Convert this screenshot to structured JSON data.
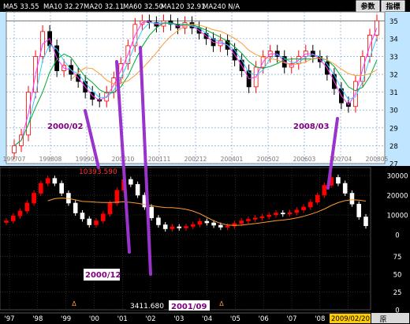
{
  "toolbar": {
    "ma_readouts": [
      {
        "label": "MA5 33.55",
        "color": "#ffffff"
      },
      {
        "label": "MA10 32.27",
        "color": "#ffffff"
      },
      {
        "label": "MA20 32.11",
        "color": "#ffffff"
      },
      {
        "label": "MA60 32.50",
        "color": "#ffffff"
      },
      {
        "label": "MA120 32.91",
        "color": "#ffffff"
      },
      {
        "label": "MA240 N/A",
        "color": "#ffffff"
      }
    ],
    "buttons": [
      "参数",
      "指標"
    ]
  },
  "chart_data": [
    {
      "type": "line",
      "panel": "top",
      "x_ticks": [
        "199707",
        "199808",
        "199909",
        "200010",
        "200111",
        "200212",
        "200401",
        "200502",
        "200603",
        "200704",
        "200805"
      ],
      "y_ticks": [
        27,
        28,
        29,
        30,
        31,
        32,
        33,
        34,
        35
      ],
      "ylim": [
        27,
        35.5
      ],
      "series": [
        {
          "kind": "candlestick-close",
          "values": [
            28.0,
            28.6,
            31.0,
            33.0,
            34.4,
            33.6,
            32.2,
            32.5,
            32.0,
            31.6,
            31.0,
            30.6,
            30.5,
            31.0,
            31.8,
            32.6,
            33.6,
            34.8,
            35.0,
            34.9,
            34.7,
            35.0,
            34.8,
            34.6,
            34.9,
            34.6,
            34.3,
            34.0,
            33.6,
            33.9,
            33.4,
            32.8,
            32.2,
            31.3,
            32.4,
            33.0,
            33.3,
            33.0,
            32.4,
            32.6,
            33.0,
            33.3,
            33.0,
            32.7,
            32.0,
            31.2,
            30.4,
            30.2,
            31.6,
            33.0,
            34.2,
            35.0
          ]
        },
        {
          "name": "MA5",
          "color": "#ff33ff"
        },
        {
          "name": "MA10",
          "color": "#33ccff"
        },
        {
          "name": "MA20",
          "color": "#00aa33"
        },
        {
          "name": "MA60",
          "color": "#ff9933"
        }
      ],
      "annotations": [
        {
          "text": "2000/02",
          "color": "#800080"
        },
        {
          "text": "2008/03",
          "color": "#800080"
        }
      ]
    },
    {
      "type": "line",
      "panel": "bottom",
      "x_ticks": [
        "'97",
        "'98",
        "'99",
        "'00",
        "'01",
        "'02",
        "'03",
        "'04",
        "'05",
        "'06",
        "'07",
        "'08",
        "'09"
      ],
      "y_ticks_upper": [
        0,
        10000,
        20000,
        30000
      ],
      "y_ticks_lower": [
        0,
        25,
        50,
        75
      ],
      "upper_ylim": [
        -4000,
        34000
      ],
      "lower_ylim": [
        0,
        100
      ],
      "series": [
        {
          "kind": "candlestick-close",
          "values": [
            7000,
            9500,
            12000,
            16000,
            21000,
            26000,
            28500,
            26000,
            21000,
            16000,
            11000,
            8000,
            5000,
            7000,
            10500,
            16000,
            22500,
            28000,
            25500,
            20000,
            14000,
            8500,
            5000,
            3000,
            4000,
            3411.68,
            4200,
            5200,
            6800,
            6000,
            4800,
            3800,
            4400,
            5700,
            7000,
            7800,
            8500,
            9200,
            10000,
            11000,
            10500,
            11200,
            12500,
            14000,
            16500,
            20000,
            25000,
            29000,
            26000,
            21000,
            15500,
            9000,
            4500
          ]
        },
        {
          "name": "MA (orange)",
          "color": "#ff9933"
        }
      ],
      "annotations": [
        {
          "text": "10393.590",
          "color": "#ff3333"
        },
        {
          "text": "3411.680",
          "color": "#ffffff"
        },
        {
          "text": "2000/12",
          "color": "#800080"
        },
        {
          "text": "2001/09",
          "color": "#800080"
        },
        {
          "text": "2009/02/20",
          "color": "#000000"
        }
      ],
      "corner_label": "原"
    }
  ]
}
